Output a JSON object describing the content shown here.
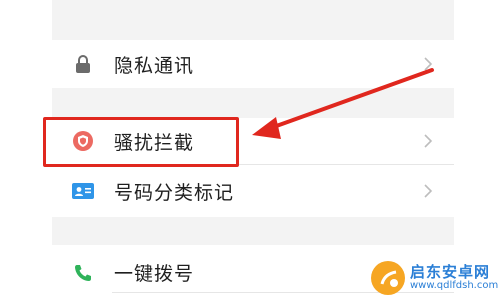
{
  "settings": {
    "items": [
      {
        "label": "隐私通讯",
        "icon": "lock-icon"
      },
      {
        "label": "骚扰拦截",
        "icon": "shield-icon"
      },
      {
        "label": "号码分类标记",
        "icon": "id-card-icon"
      },
      {
        "label": "一键拨号",
        "icon": "phone-icon"
      }
    ]
  },
  "annotation": {
    "color": "#e0271e"
  },
  "watermark": {
    "brand": "启东安卓网",
    "url": "www.qdlfdsh.com"
  }
}
